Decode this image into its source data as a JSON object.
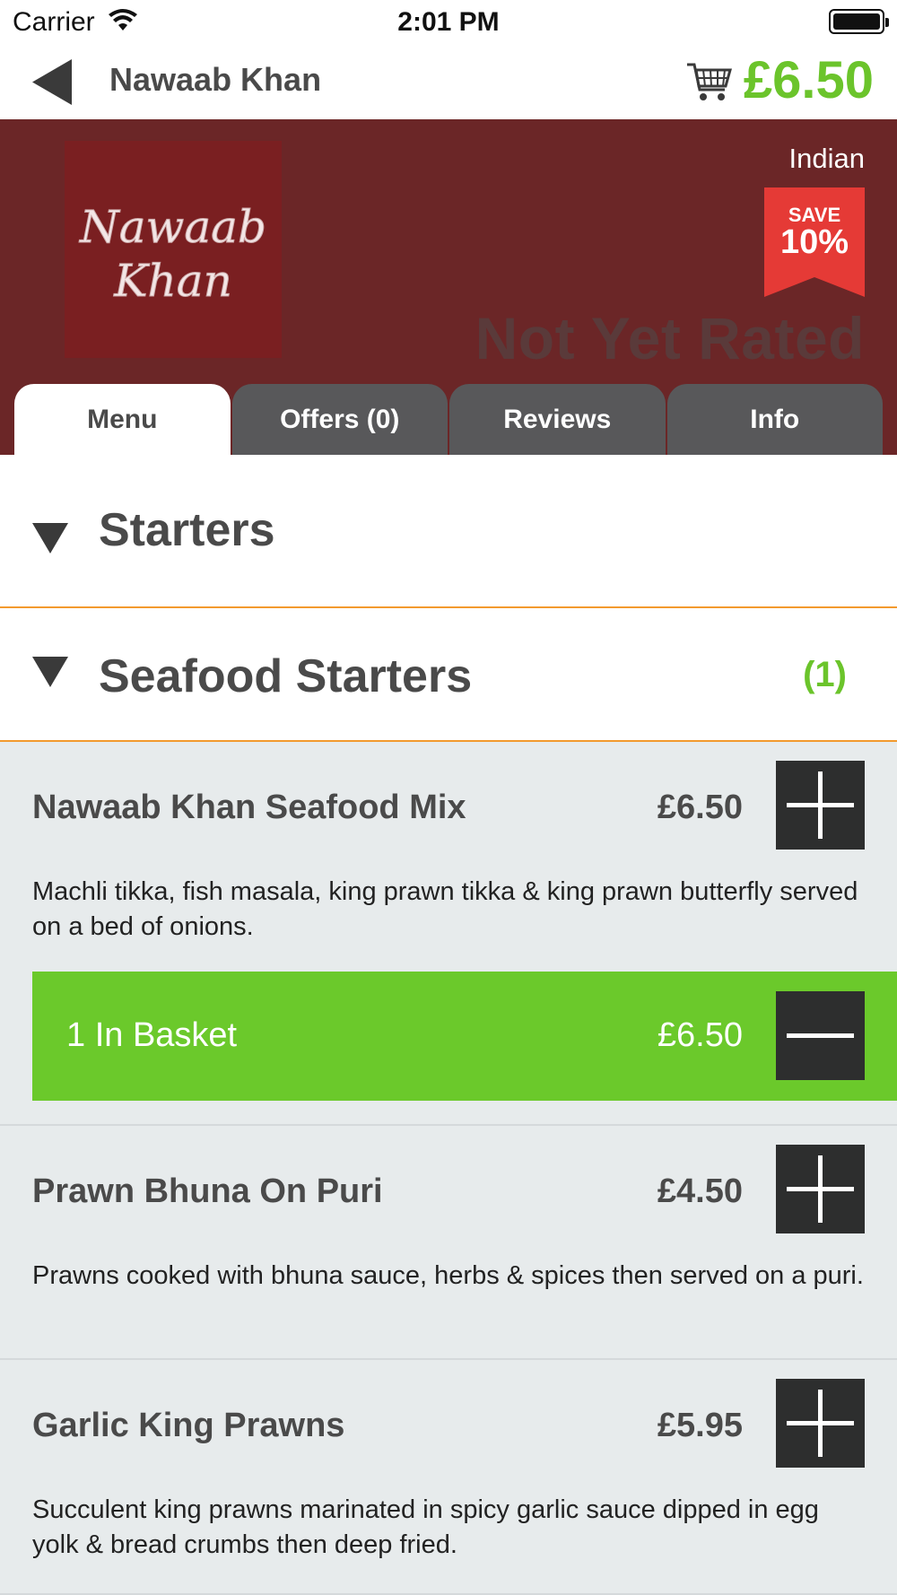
{
  "status_bar": {
    "carrier": "Carrier",
    "time": "2:01 PM"
  },
  "nav": {
    "title": "Nawaab Khan",
    "cart_total": "£6.50"
  },
  "restaurant": {
    "logo_text": [
      "Nawaab",
      "Khan"
    ],
    "cuisine": "Indian",
    "save_label": "SAVE",
    "save_percent": "10%",
    "rating": "Not Yet Rated"
  },
  "tabs": [
    {
      "label": "Menu",
      "active": true
    },
    {
      "label": "Offers (0)",
      "active": false
    },
    {
      "label": "Reviews",
      "active": false
    },
    {
      "label": "Info",
      "active": false
    }
  ],
  "sections": [
    {
      "title": "Starters",
      "count": ""
    },
    {
      "title": "Seafood Starters",
      "count": "(1)"
    }
  ],
  "items": [
    {
      "name": "Nawaab Khan Seafood Mix",
      "price": "£6.50",
      "description": "Machli tikka, fish masala, king prawn tikka & king prawn butterfly served on a bed of onions.",
      "basket": {
        "label": "1 In Basket",
        "price": "£6.50"
      }
    },
    {
      "name": "Prawn Bhuna On Puri",
      "price": "£4.50",
      "description": "Prawns cooked with bhuna sauce, herbs & spices then served on a puri."
    },
    {
      "name": "Garlic King Prawns",
      "price": "£5.95",
      "description": "Succulent king prawns marinated in spicy garlic sauce dipped in egg yolk & bread crumbs then deep fried."
    }
  ],
  "colors": {
    "accent_green": "#6bc42b",
    "banner": "#6b2627",
    "section_divider": "#f39a2e",
    "save_badge": "#e53a36"
  }
}
